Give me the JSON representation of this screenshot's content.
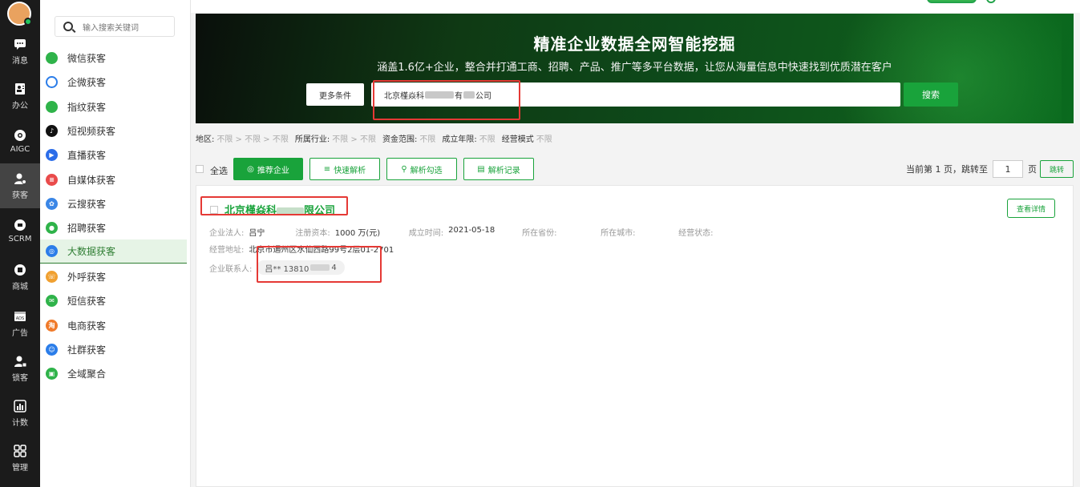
{
  "rail": {
    "items": [
      {
        "label": "消息",
        "icon": "chat-bubble-icon"
      },
      {
        "label": "办公",
        "icon": "contacts-icon"
      },
      {
        "label": "AIGC",
        "icon": "brain-icon"
      },
      {
        "label": "获客",
        "icon": "user-add-icon"
      },
      {
        "label": "SCRM",
        "icon": "scrm-icon"
      },
      {
        "label": "商城",
        "icon": "shop-icon"
      },
      {
        "label": "广告",
        "icon": "ads-icon"
      },
      {
        "label": "锁客",
        "icon": "user-lock-icon"
      },
      {
        "label": "计数",
        "icon": "bar-chart-icon"
      },
      {
        "label": "管理",
        "icon": "grid-icon"
      }
    ],
    "active": "获客"
  },
  "menu": {
    "search_placeholder": "输入搜索关键词",
    "items": [
      {
        "label": "微信获客",
        "color": "#2fb34a",
        "icon": "wechat-icon"
      },
      {
        "label": "企微获客",
        "color": "#2b7de9",
        "icon": "wecom-icon"
      },
      {
        "label": "指纹获客",
        "color": "#2fb34a",
        "icon": "fingerprint-icon"
      },
      {
        "label": "短视频获客",
        "color": "#111111",
        "icon": "tiktok-icon"
      },
      {
        "label": "直播获客",
        "color": "#2b6de9",
        "icon": "live-icon"
      },
      {
        "label": "自媒体获客",
        "color": "#e94b4b",
        "icon": "media-icon"
      },
      {
        "label": "云搜获客",
        "color": "#3a86e6",
        "icon": "cloud-search-icon"
      },
      {
        "label": "招聘获客",
        "color": "#2fb34a",
        "icon": "recruit-icon"
      },
      {
        "label": "大数据获客",
        "color": "#2b7de9",
        "icon": "bigdata-icon"
      },
      {
        "label": "外呼获客",
        "color": "#f0a030",
        "icon": "phone-icon"
      },
      {
        "label": "短信获客",
        "color": "#2fb34a",
        "icon": "sms-icon"
      },
      {
        "label": "电商获客",
        "color": "#f07a2a",
        "icon": "ecommerce-icon"
      },
      {
        "label": "社群获客",
        "color": "#2b7de9",
        "icon": "community-icon"
      },
      {
        "label": "全域聚合",
        "color": "#2fb34a",
        "icon": "aggregate-icon"
      }
    ],
    "active": "大数据获客"
  },
  "banner": {
    "title": "精准企业数据全网智能挖掘",
    "subtitle": "涵盖1.6亿+企业，整合并打通工商、招聘、产品、推广等多平台数据，让您从海量信息中快速找到优质潜在客户",
    "more_label": "更多条件",
    "keyword_prefix": "北京槿焱科",
    "keyword_mid": "有",
    "keyword_suffix": "公司",
    "search_label": "搜索"
  },
  "filters": [
    {
      "label": "地区:",
      "value": "不限 > 不限 > 不限"
    },
    {
      "label": "所属行业:",
      "value": "不限 > 不限"
    },
    {
      "label": "资金范围:",
      "value": "不限"
    },
    {
      "label": "成立年限:",
      "value": "不限"
    },
    {
      "label": "经营模式",
      "value": "不限"
    }
  ],
  "toolbar": {
    "select_all": "全选",
    "recommend": "推荐企业",
    "quick_parse": "快速解析",
    "parse_selected": "解析勾选",
    "parse_log": "解析记录",
    "pager_prefix": "当前第 1 页，跳转至",
    "page_value": "1",
    "pager_suffix": "页",
    "jump": "跳转"
  },
  "result": {
    "name_prefix": "北京槿焱科",
    "name_suffix": "限公司",
    "detail_label": "查看详情",
    "legal_label": "企业法人:",
    "legal_value": "吕宁",
    "capital_label": "注册资本:",
    "capital_value": "1000 万(元)",
    "founded_label": "成立时间:",
    "founded_value": "2021-05-18",
    "province_label": "所在省份:",
    "city_label": "所在城市:",
    "status_label": "经营状态:",
    "address_label": "经营地址:",
    "address_value": "北京市通州区水仙西路99号2层01-2701",
    "contact_label": "企业联系人:",
    "contact_prefix": "吕** 13810",
    "contact_suffix": "4"
  }
}
